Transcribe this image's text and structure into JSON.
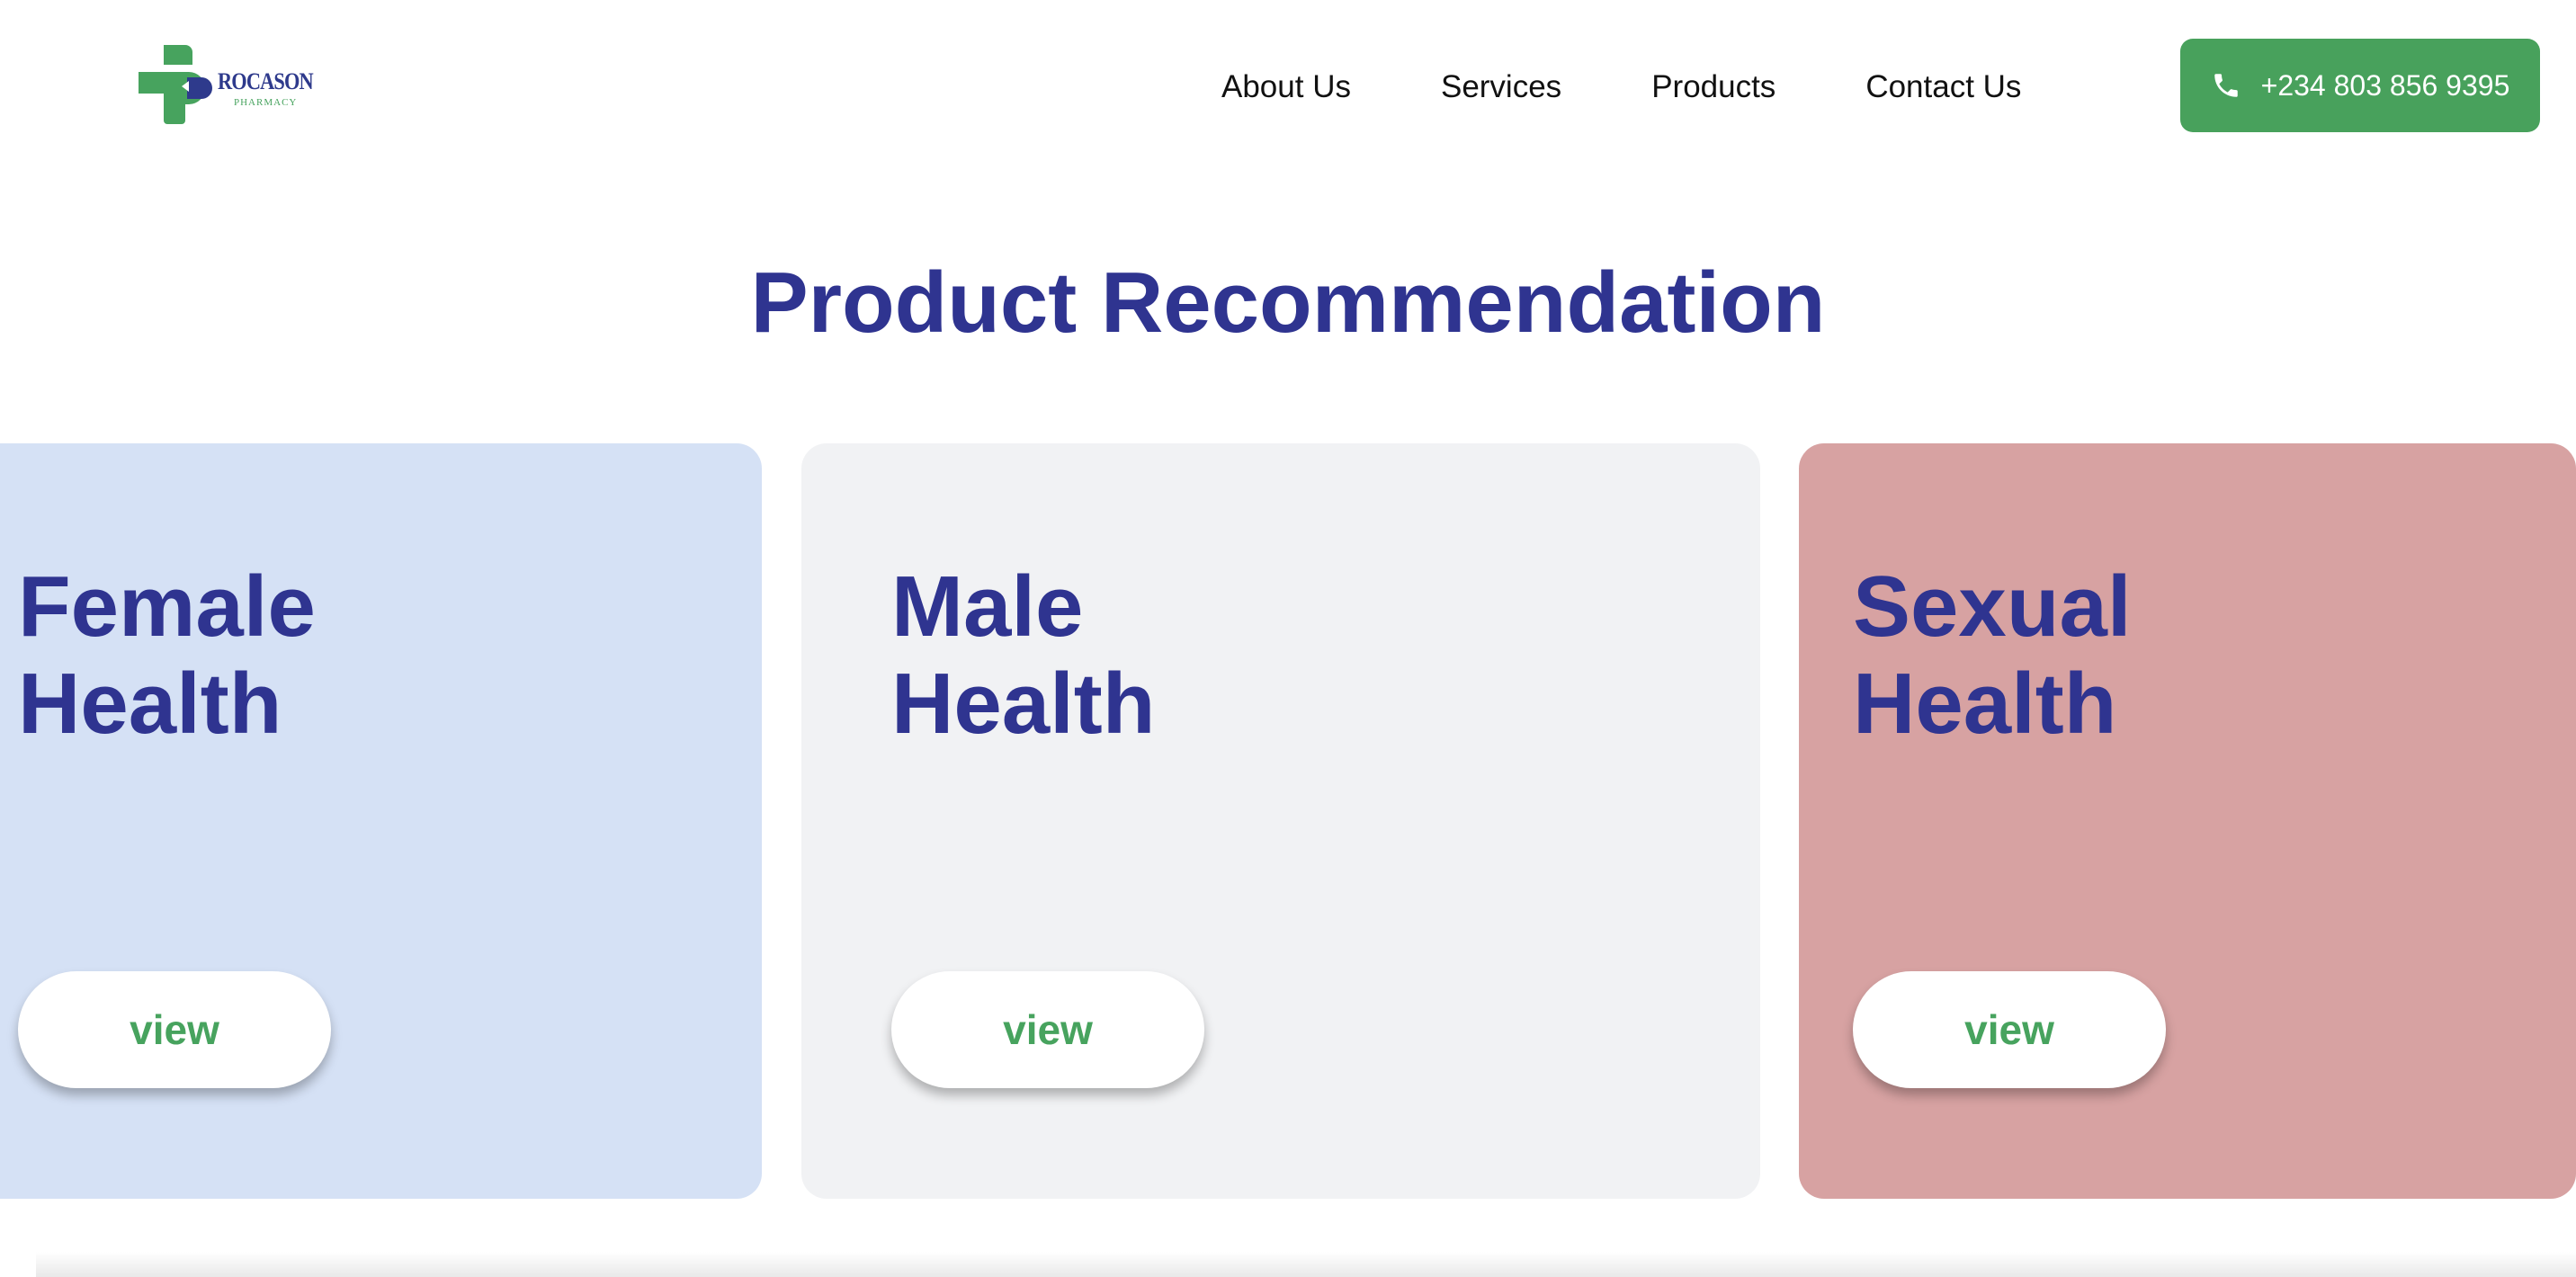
{
  "brand": {
    "name": "ROCASON",
    "subtitle": "PHARMACY",
    "icon": "rocason-logo",
    "colors": {
      "green": "#47a35e",
      "navy": "#2e3a8c"
    }
  },
  "nav": {
    "items": [
      {
        "label": "About Us"
      },
      {
        "label": "Services"
      },
      {
        "label": "Products"
      },
      {
        "label": "Contact Us"
      }
    ]
  },
  "contact": {
    "phone": "+234 803 856 9395",
    "icon": "phone-icon",
    "button_color": "#48a15c"
  },
  "main": {
    "title": "Product Recommendation",
    "title_color": "#2f3490",
    "cards": [
      {
        "title_line1": "Female",
        "title_line2": "Health",
        "button_label": "view",
        "background": "#d5e1f5"
      },
      {
        "title_line1": "Male",
        "title_line2": "Health",
        "button_label": "view",
        "background": "#f1f2f4"
      },
      {
        "title_line1": "Sexual",
        "title_line2": "Health",
        "button_label": "view",
        "background": "#d7a2a2"
      }
    ]
  }
}
